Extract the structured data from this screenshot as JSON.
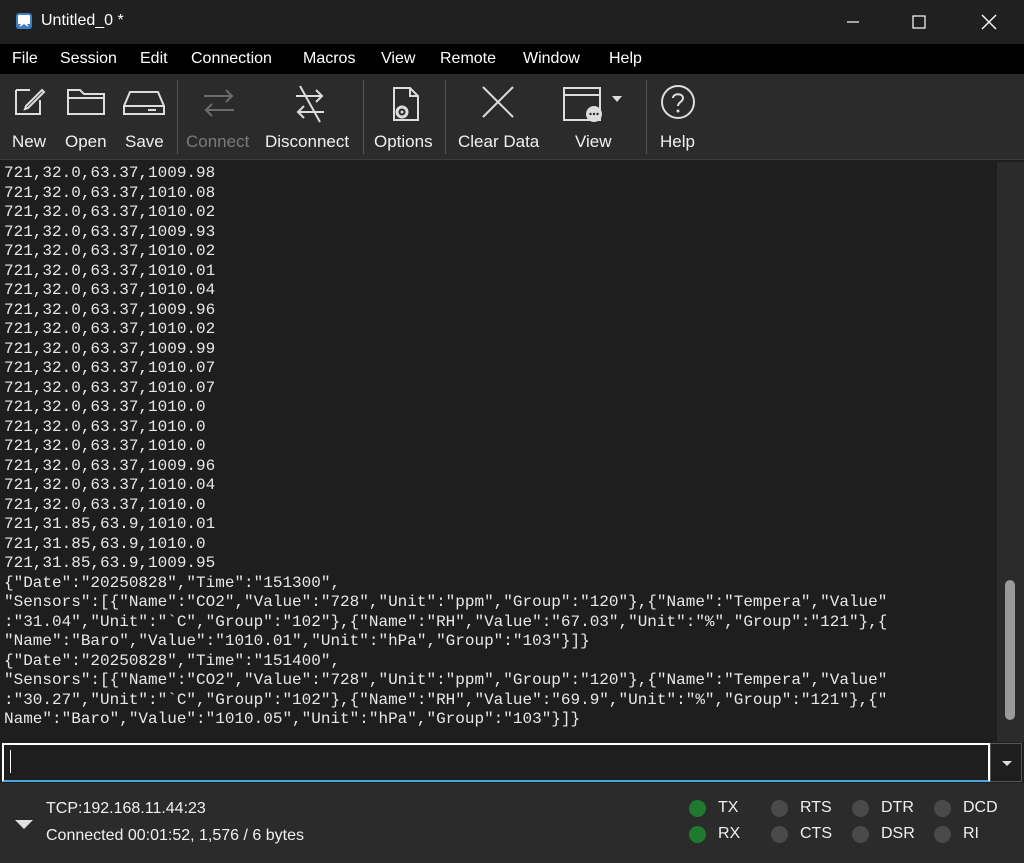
{
  "window": {
    "title": "Untitled_0 *"
  },
  "menu": [
    "File",
    "Session",
    "Edit",
    "Connection",
    "Macros",
    "View",
    "Remote",
    "Window",
    "Help"
  ],
  "toolbar": {
    "new": "New",
    "open": "Open",
    "save": "Save",
    "connect": "Connect",
    "disconnect": "Disconnect",
    "options": "Options",
    "clear": "Clear Data",
    "view": "View",
    "help": "Help"
  },
  "terminal": {
    "lines": [
      "721,32.0,63.37,1009.98",
      "721,32.0,63.37,1010.08",
      "721,32.0,63.37,1010.02",
      "721,32.0,63.37,1009.93",
      "721,32.0,63.37,1010.02",
      "721,32.0,63.37,1010.01",
      "721,32.0,63.37,1010.04",
      "721,32.0,63.37,1009.96",
      "721,32.0,63.37,1010.02",
      "721,32.0,63.37,1009.99",
      "721,32.0,63.37,1010.07",
      "721,32.0,63.37,1010.07",
      "721,32.0,63.37,1010.0",
      "721,32.0,63.37,1010.0",
      "721,32.0,63.37,1010.0",
      "721,32.0,63.37,1009.96",
      "721,32.0,63.37,1010.04",
      "721,32.0,63.37,1010.0",
      "721,31.85,63.9,1010.01",
      "721,31.85,63.9,1010.0",
      "721,31.85,63.9,1009.95",
      "{\"Date\":\"20250828\",\"Time\":\"151300\",",
      "\"Sensors\":[{\"Name\":\"CO2\",\"Value\":\"728\",\"Unit\":\"ppm\",\"Group\":\"120\"},{\"Name\":\"Tempera\",\"Value\"",
      ":\"31.04\",\"Unit\":\"`C\",\"Group\":\"102\"},{\"Name\":\"RH\",\"Value\":\"67.03\",\"Unit\":\"%\",\"Group\":\"121\"},{",
      "\"Name\":\"Baro\",\"Value\":\"1010.01\",\"Unit\":\"hPa\",\"Group\":\"103\"}]}",
      "{\"Date\":\"20250828\",\"Time\":\"151400\",",
      "\"Sensors\":[{\"Name\":\"CO2\",\"Value\":\"728\",\"Unit\":\"ppm\",\"Group\":\"120\"},{\"Name\":\"Tempera\",\"Value\"",
      ":\"30.27\",\"Unit\":\"`C\",\"Group\":\"102\"},{\"Name\":\"RH\",\"Value\":\"69.9\",\"Unit\":\"%\",\"Group\":\"121\"},{\"",
      "Name\":\"Baro\",\"Value\":\"1010.05\",\"Unit\":\"hPa\",\"Group\":\"103\"}]}"
    ]
  },
  "status": {
    "connection": "TCP:192.168.11.44:23",
    "detail": "Connected 00:01:52, 1,576 / 6 bytes",
    "leds": [
      {
        "label": "TX",
        "on": true
      },
      {
        "label": "RX",
        "on": true
      },
      {
        "label": "RTS",
        "on": false
      },
      {
        "label": "CTS",
        "on": false
      },
      {
        "label": "DTR",
        "on": false
      },
      {
        "label": "DSR",
        "on": false
      },
      {
        "label": "DCD",
        "on": false
      },
      {
        "label": "RI",
        "on": false
      }
    ]
  }
}
